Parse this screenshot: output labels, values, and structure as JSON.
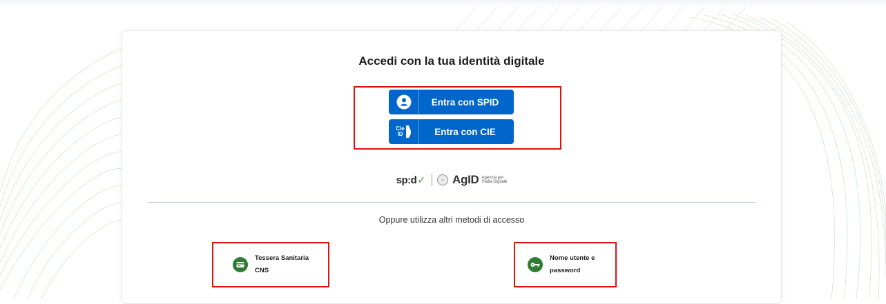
{
  "login": {
    "title": "Accedi con la tua identità digitale",
    "spid_button_label": "Entra con SPID",
    "cie_button_label": "Entra con CIE",
    "cie_icon_text_top": "Cie",
    "cie_icon_text_bottom": "ID",
    "alt_methods_text": "Oppure utilizza altri metodi di accesso"
  },
  "logos": {
    "spid_text": "sp:d",
    "spid_check": "✓",
    "agid_text": "AgID",
    "agid_sub_line1": "Agenzia per",
    "agid_sub_line2": "l'Italia Digitale"
  },
  "alt_methods": {
    "cns_label": "Tessera Sanitaria CNS",
    "password_label": "Nome utente e password"
  },
  "icons": {
    "spid_button": "user-icon",
    "cie_button": "cie-id-icon",
    "cns": "card-icon",
    "password": "key-icon"
  },
  "colors": {
    "primary_blue": "#0066cc",
    "accent_green": "#2e7d32",
    "highlight_red": "#e01010",
    "divider": "#b8d4b8"
  }
}
